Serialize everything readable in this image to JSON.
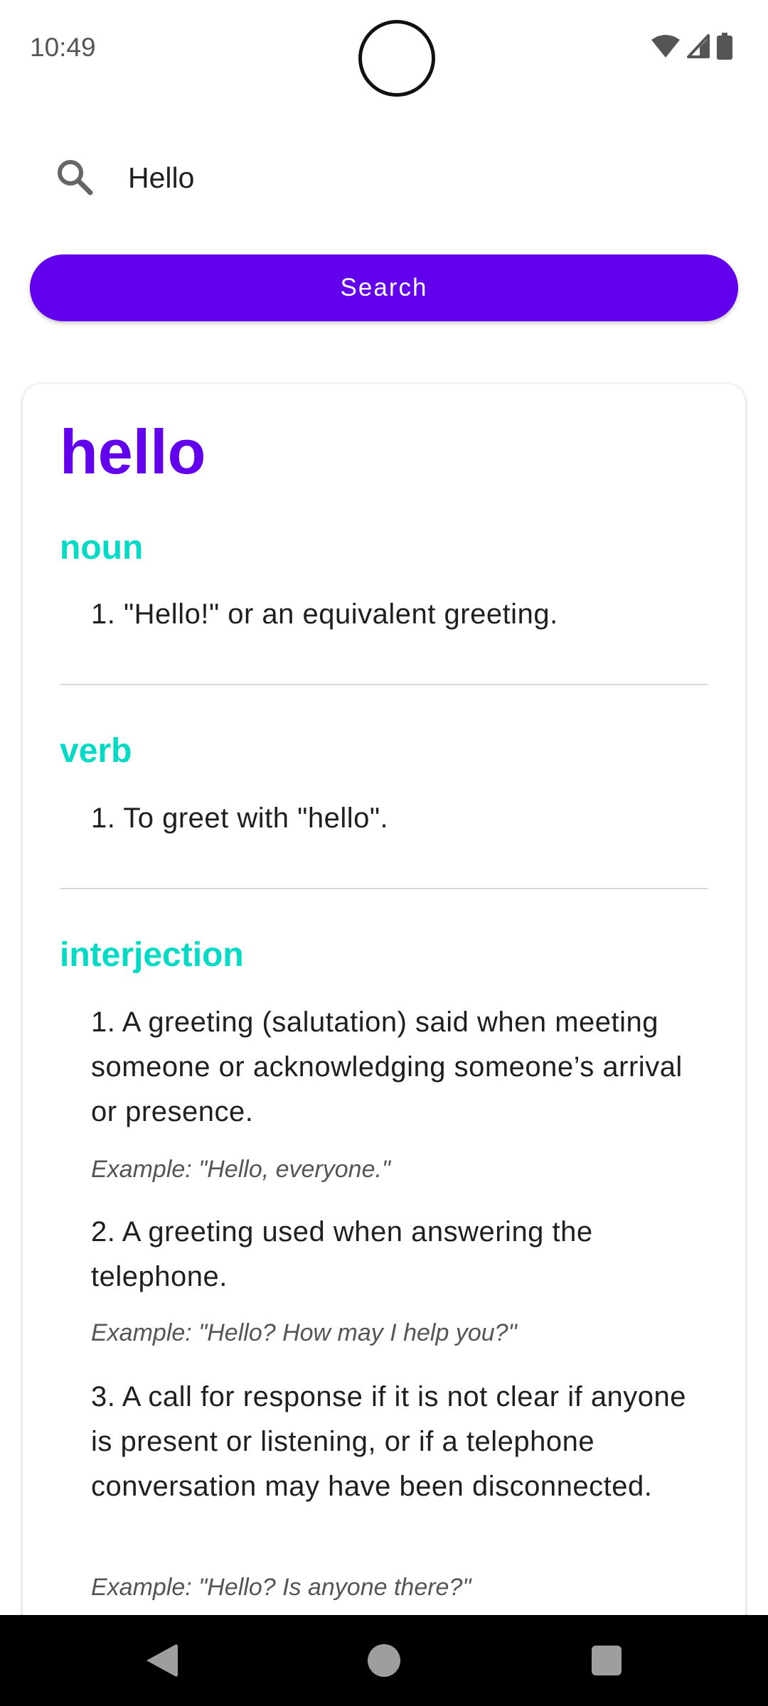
{
  "status_bar": {
    "time": "10:49",
    "icons": [
      "wifi-icon",
      "signal-icon",
      "battery-icon"
    ]
  },
  "search": {
    "value": "Hello",
    "button_label": "Search"
  },
  "result": {
    "word": "hello",
    "sections": [
      {
        "part_of_speech": "noun",
        "definitions": [
          {
            "text": "1. \"Hello!\" or an equivalent greeting."
          }
        ]
      },
      {
        "part_of_speech": "verb",
        "definitions": [
          {
            "text": "1. To greet with \"hello\"."
          }
        ]
      },
      {
        "part_of_speech": "interjection",
        "definitions": [
          {
            "text": "1. A greeting (salutation) said when meeting someone or acknowledging someone’s arrival or presence.",
            "example": "Example: \"Hello, everyone.\""
          },
          {
            "text": "2. A greeting used when answering the telephone.",
            "example": "Example: \"Hello? How may I help you?\""
          },
          {
            "text": "3. A call for response if it is not clear if anyone is present or listening, or if a telephone conversation may have been disconnected.",
            "example": "Example: \"Hello? Is anyone there?\""
          }
        ]
      }
    ]
  },
  "colors": {
    "primary": "#6200ee",
    "secondary": "#03dac5"
  },
  "nav_bar": {
    "buttons": [
      "back-icon",
      "home-icon",
      "recents-icon"
    ]
  }
}
